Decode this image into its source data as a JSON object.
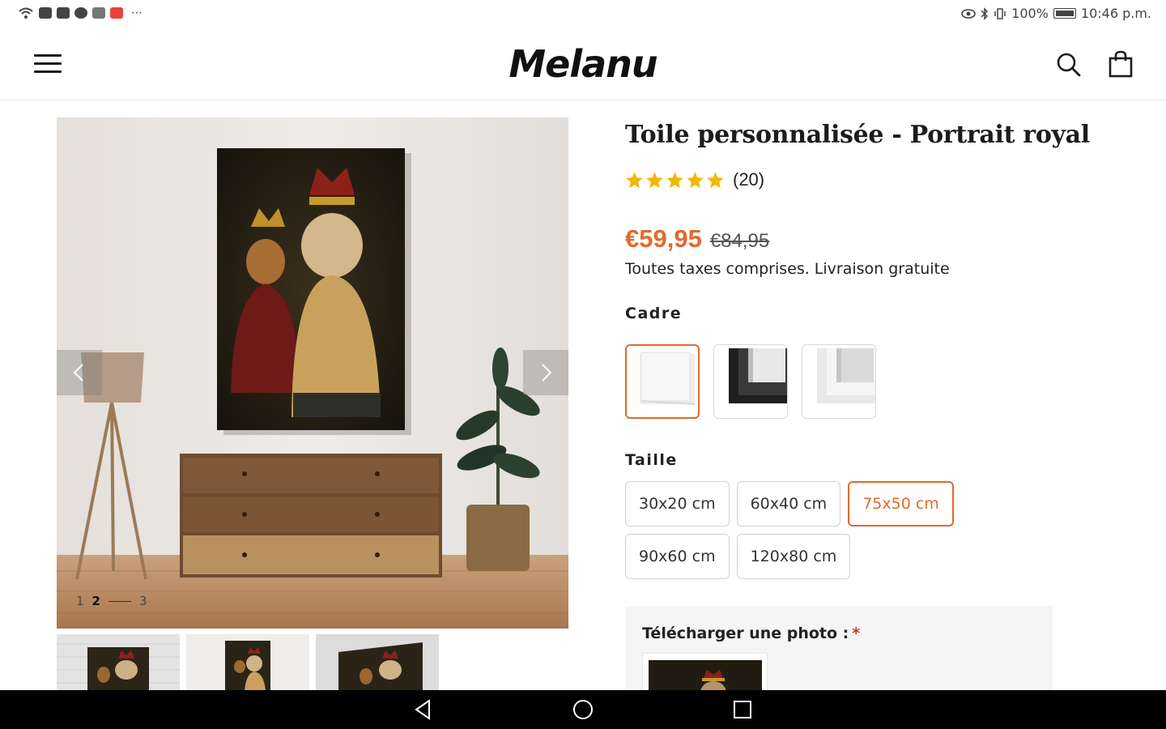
{
  "status_bar": {
    "left_icons": [
      "wifi-icon",
      "youtube-icon",
      "news-icon",
      "pinterest-icon",
      "temu-icon",
      "shopping-icon",
      "more-icon"
    ],
    "more": "⋯",
    "battery_percent": "100%",
    "time": "10:46 p.m."
  },
  "header": {
    "logo": "Melanu",
    "menu_icon": "hamburger-menu-icon",
    "search_icon": "search-icon",
    "cart_icon": "shopping-bag-icon"
  },
  "gallery": {
    "pager": [
      "1",
      "2",
      "3"
    ],
    "active_index": 2,
    "thumbnail_count": 3
  },
  "product": {
    "title": "Toile personnalisée - Portrait royal",
    "rating_stars": 5,
    "rating_count": "(20)",
    "price_now": "€59,95",
    "price_old": "€84,95",
    "taxes_note": "Toutes taxes comprises. Livraison gratuite",
    "frame_label": "Cadre",
    "frames": [
      {
        "name": "sans-cadre",
        "selected": true
      },
      {
        "name": "cadre-noir",
        "selected": false
      },
      {
        "name": "cadre-blanc",
        "selected": false
      }
    ],
    "size_label": "Taille",
    "sizes": [
      {
        "label": "30x20 cm",
        "selected": false
      },
      {
        "label": "60x40 cm",
        "selected": false
      },
      {
        "label": "75x50 cm",
        "selected": true
      },
      {
        "label": "90x60 cm",
        "selected": false
      },
      {
        "label": "120x80 cm",
        "selected": false
      }
    ],
    "upload_label": "Télécharger une photo :",
    "upload_required": "*"
  },
  "colors": {
    "accent": "#e06a2c",
    "star": "#f2b705",
    "required": "#d9312b"
  },
  "nav_bar": [
    "back-icon",
    "home-icon",
    "recents-icon"
  ]
}
